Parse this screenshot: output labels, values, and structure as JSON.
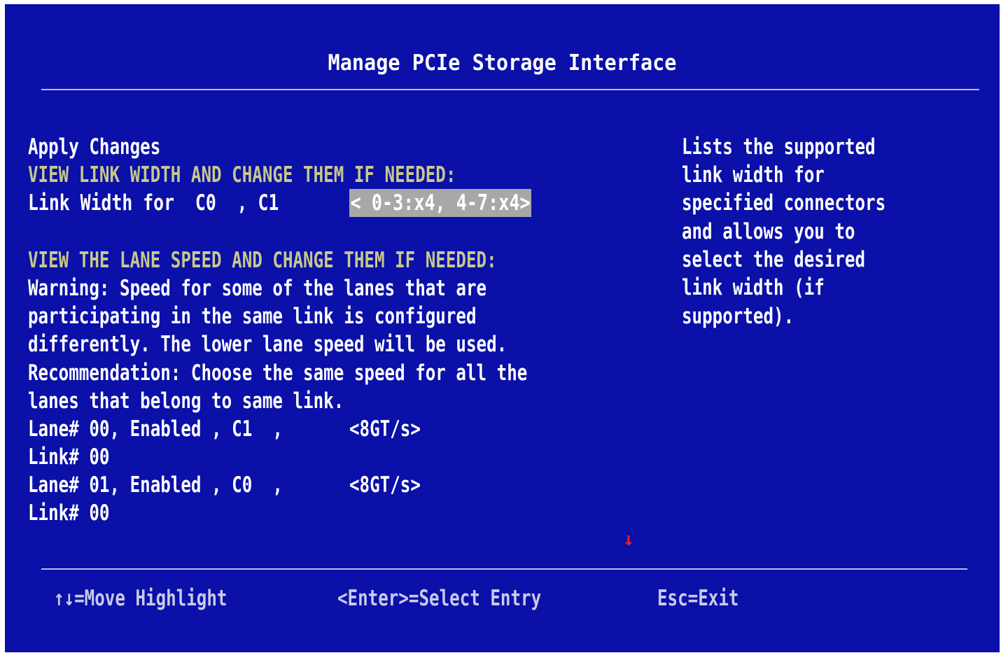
{
  "screen": {
    "title": "Manage PCIe Storage Interface",
    "colors": {
      "background": "#0a10a8",
      "text": "#ffffff",
      "section_header": "#c8c88a",
      "highlight": "#a8a8a8",
      "scroll_arrow": "#e8232c"
    }
  },
  "main": {
    "apply_changes": "Apply Changes",
    "link_width_header": "VIEW LINK WIDTH AND CHANGE THEM IF NEEDED:",
    "link_width_label": "Link Width for  C0  , C1",
    "link_width_value": "< 0-3:x4, 4-7:x4>",
    "lane_speed_header": "VIEW THE LANE SPEED AND CHANGE THEM IF NEEDED:",
    "warning_lines": [
      "Warning: Speed for some of the lanes that are",
      "participating in the same link is configured",
      "differently. The lower lane speed will be used.",
      "Recommendation: Choose the same speed for all the",
      "lanes that belong to same link."
    ],
    "lanes": [
      {
        "label": "Lane# 00, Enabled , C1  ,",
        "speed": "<8GT/s>",
        "link": "Link# 00"
      },
      {
        "label": "Lane# 01, Enabled , C0  ,",
        "speed": "<8GT/s>",
        "link": "Link# 00"
      }
    ],
    "scroll_indicator": "↓"
  },
  "help": {
    "lines": [
      "Lists the supported",
      "link width for",
      "specified connectors",
      "and allows you to",
      "select the desired",
      "link width (if",
      "supported)."
    ]
  },
  "footer": {
    "move": "↑↓=Move Highlight",
    "select": "<Enter>=Select Entry",
    "exit": "Esc=Exit"
  }
}
